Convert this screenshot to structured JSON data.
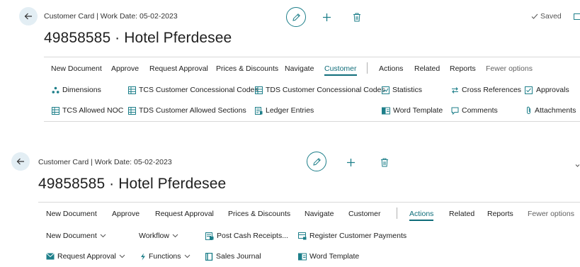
{
  "panel1": {
    "breadcrumb": "Customer Card | Work Date: 05-02-2023",
    "title": "49858585 · Hotel Pferdesee",
    "saved_label": "Saved",
    "tabs": [
      "New Document",
      "Approve",
      "Request Approval",
      "Prices & Discounts",
      "Navigate",
      "Customer",
      "Actions",
      "Related",
      "Reports",
      "Fewer options"
    ],
    "active_tab": "Customer",
    "actions_row1": [
      "Dimensions",
      "TCS Customer Concessional Codes",
      "TDS Customer Concessional Codes",
      "Statistics",
      "Cross References",
      "Approvals"
    ],
    "actions_row2": [
      "TCS Allowed NOC",
      "TDS Customer Allowed Sections",
      "Ledger Entries",
      "Word Template",
      "Comments",
      "Attachments"
    ]
  },
  "panel2": {
    "breadcrumb": "Customer Card | Work Date: 05-02-2023",
    "title": "49858585 · Hotel Pferdesee",
    "tabs": [
      "New Document",
      "Approve",
      "Request Approval",
      "Prices & Discounts",
      "Navigate",
      "Customer",
      "Actions",
      "Related",
      "Reports",
      "Fewer options"
    ],
    "active_tab": "Actions",
    "actions_row1": [
      "New Document",
      "Workflow",
      "Post Cash Receipts...",
      "Register Customer Payments"
    ],
    "actions_row2": [
      "Request Approval",
      "Functions",
      "Sales Journal",
      "Word Template"
    ]
  },
  "colors": {
    "accent": "#0f6d7a",
    "back_bg": "#e3eef4"
  }
}
